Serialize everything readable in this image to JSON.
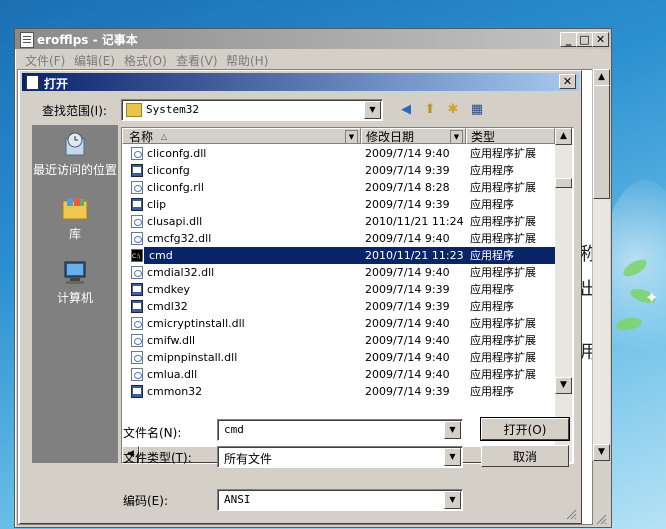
{
  "notepad": {
    "title": "erofflps - 记事本",
    "menu": [
      "文件(F)",
      "编辑(E)",
      "格式(O)",
      "查看(V)",
      "帮助(H)"
    ],
    "bg_chars": [
      "称",
      "出",
      "用"
    ]
  },
  "dialog": {
    "title": "打开",
    "look_in_label": "查找范围(I):",
    "look_in_value": "System32",
    "places": [
      {
        "label": "最近访问的位置",
        "icon": "recent-places-icon"
      },
      {
        "label": "库",
        "icon": "libraries-icon"
      },
      {
        "label": "计算机",
        "icon": "computer-icon"
      }
    ],
    "columns": {
      "name": "名称",
      "date": "修改日期",
      "type": "类型"
    },
    "files": [
      {
        "name": "cliconfg.dll",
        "date": "2009/7/14 9:40",
        "type": "应用程序扩展",
        "icon": "dll"
      },
      {
        "name": "cliconfg",
        "date": "2009/7/14 9:39",
        "type": "应用程序",
        "icon": "exe"
      },
      {
        "name": "cliconfg.rll",
        "date": "2009/7/14 8:28",
        "type": "应用程序扩展",
        "icon": "dll"
      },
      {
        "name": "clip",
        "date": "2009/7/14 9:39",
        "type": "应用程序",
        "icon": "exe"
      },
      {
        "name": "clusapi.dll",
        "date": "2010/11/21 11:24",
        "type": "应用程序扩展",
        "icon": "dll"
      },
      {
        "name": "cmcfg32.dll",
        "date": "2009/7/14 9:40",
        "type": "应用程序扩展",
        "icon": "dll"
      },
      {
        "name": "cmd",
        "date": "2010/11/21 11:23",
        "type": "应用程序",
        "icon": "cmd",
        "selected": true
      },
      {
        "name": "cmdial32.dll",
        "date": "2009/7/14 9:40",
        "type": "应用程序扩展",
        "icon": "dll"
      },
      {
        "name": "cmdkey",
        "date": "2009/7/14 9:39",
        "type": "应用程序",
        "icon": "exe"
      },
      {
        "name": "cmdl32",
        "date": "2009/7/14 9:39",
        "type": "应用程序",
        "icon": "exe"
      },
      {
        "name": "cmicryptinstall.dll",
        "date": "2009/7/14 9:40",
        "type": "应用程序扩展",
        "icon": "dll"
      },
      {
        "name": "cmifw.dll",
        "date": "2009/7/14 9:40",
        "type": "应用程序扩展",
        "icon": "dll"
      },
      {
        "name": "cmipnpinstall.dll",
        "date": "2009/7/14 9:40",
        "type": "应用程序扩展",
        "icon": "dll"
      },
      {
        "name": "cmlua.dll",
        "date": "2009/7/14 9:40",
        "type": "应用程序扩展",
        "icon": "dll"
      },
      {
        "name": "cmmon32",
        "date": "2009/7/14 9:39",
        "type": "应用程序",
        "icon": "exe"
      }
    ],
    "filename_label": "文件名(N):",
    "filename_value": "cmd",
    "filetype_label": "文件类型(T):",
    "filetype_value": "所有文件",
    "encoding_label": "编码(E):",
    "encoding_value": "ANSI",
    "open_button": "打开(O)",
    "cancel_button": "取消"
  },
  "colors": {
    "selection": "#0a246a",
    "dialog_face": "#d4d0c8",
    "places_bg": "#808080"
  }
}
